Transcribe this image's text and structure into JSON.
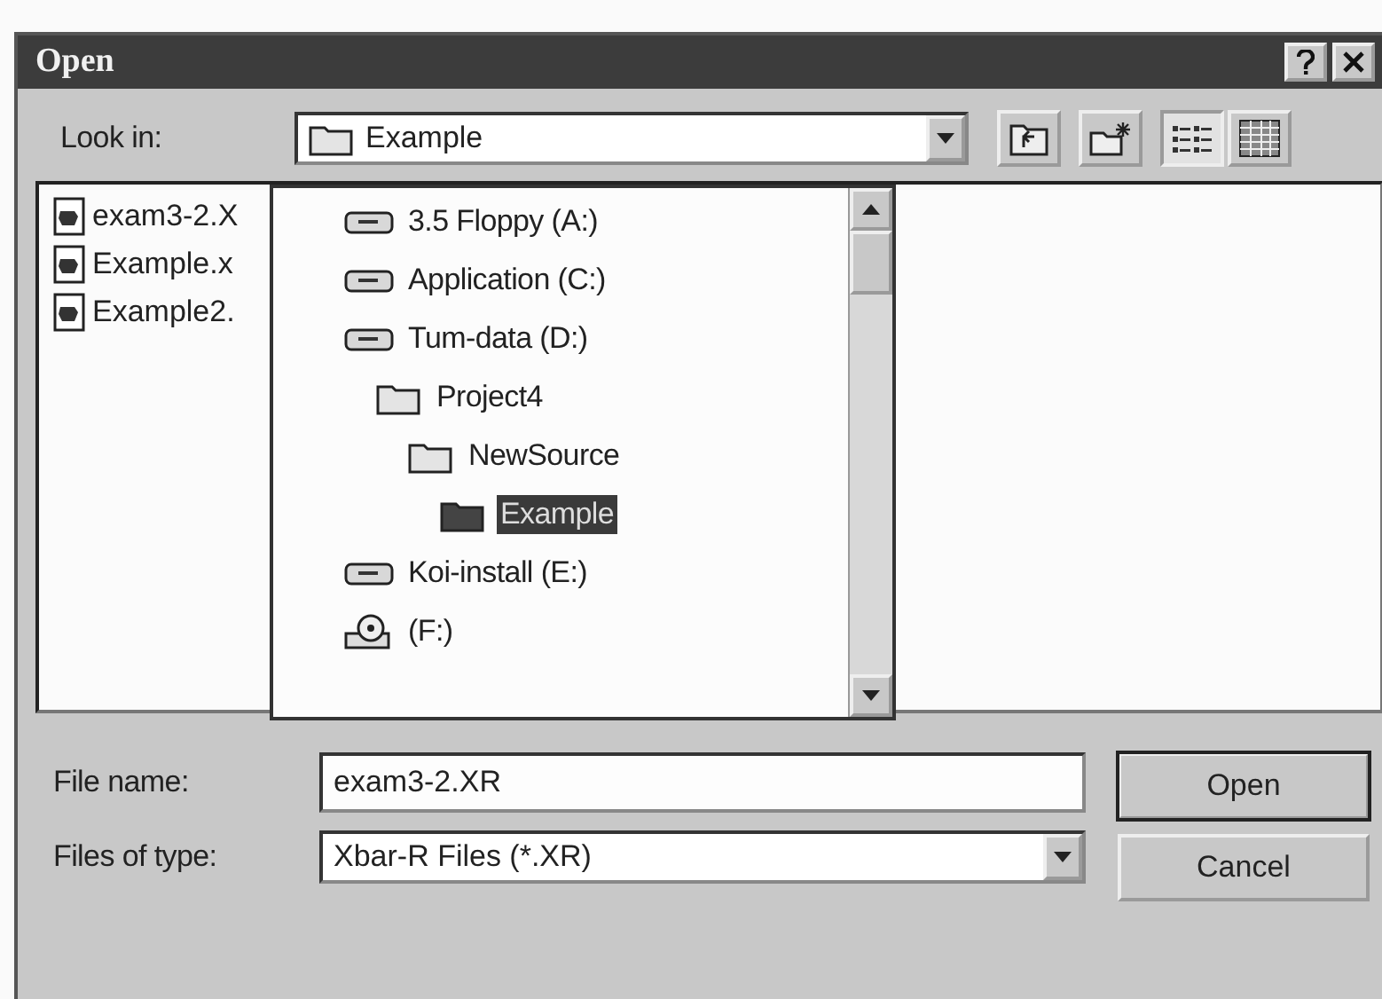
{
  "window": {
    "title": "Open"
  },
  "look_in": {
    "label": "Look in:",
    "value": "Example"
  },
  "toolbar": [
    {
      "kind": "up",
      "pressed": false
    },
    {
      "kind": "new-folder",
      "pressed": false
    },
    {
      "kind": "list",
      "pressed": true
    },
    {
      "kind": "details",
      "pressed": false
    }
  ],
  "files": [
    {
      "name": "exam3-2.X"
    },
    {
      "name": "Example.x"
    },
    {
      "name": "Example2."
    }
  ],
  "look_in_dropdown": {
    "items": [
      {
        "kind": "drive",
        "label": "3.5 Floppy (A:)",
        "selected": false
      },
      {
        "kind": "drive",
        "label": "Application (C:)",
        "selected": false
      },
      {
        "kind": "drive",
        "label": "Tum-data (D:)",
        "selected": false,
        "children": [
          {
            "kind": "folder",
            "label": "Project4",
            "selected": false,
            "children": [
              {
                "kind": "folder",
                "label": "NewSource",
                "selected": false,
                "children": [
                  {
                    "kind": "folder",
                    "label": "Example",
                    "selected": true
                  }
                ]
              }
            ]
          }
        ]
      },
      {
        "kind": "drive",
        "label": "Koi-install (E:)",
        "selected": false
      },
      {
        "kind": "cdrom",
        "label": "(F:)",
        "selected": false
      }
    ]
  },
  "file_name": {
    "label": "File name:",
    "value": "exam3-2.XR"
  },
  "file_type": {
    "label": "Files of type:",
    "value": "Xbar-R Files (*.XR)"
  },
  "buttons": [
    {
      "label": "Open",
      "default": true
    },
    {
      "label": "Cancel",
      "default": false
    }
  ]
}
